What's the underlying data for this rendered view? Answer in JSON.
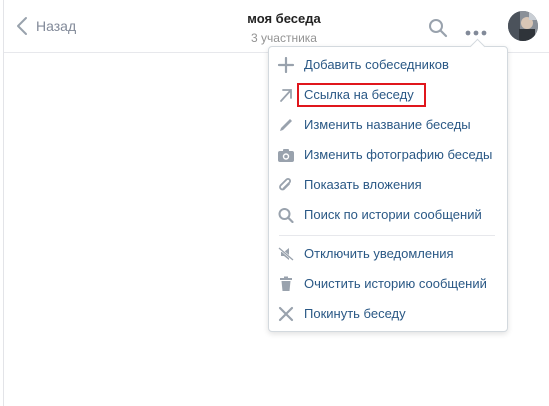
{
  "header": {
    "back_label": "Назад",
    "title": "моя беседа",
    "subtitle": "3 участника"
  },
  "icons": {
    "back": "chevron-left-icon",
    "search": "search-icon",
    "more": "more-horizontal-icon"
  },
  "menu": {
    "items": [
      {
        "label": "Добавить собеседников",
        "icon": "plus-icon"
      },
      {
        "label": "Ссылка на беседу",
        "icon": "arrow-up-right-icon"
      },
      {
        "label": "Изменить название беседы",
        "icon": "pencil-icon"
      },
      {
        "label": "Изменить фотографию беседы",
        "icon": "camera-icon"
      },
      {
        "label": "Показать вложения",
        "icon": "paperclip-icon"
      },
      {
        "label": "Поиск по истории сообщений",
        "icon": "search-icon"
      },
      {
        "label": "Отключить уведомления",
        "icon": "bell-off-icon"
      },
      {
        "label": "Очистить историю сообщений",
        "icon": "trash-icon"
      },
      {
        "label": "Покинуть беседу",
        "icon": "close-icon"
      }
    ]
  },
  "colors": {
    "link": "#2a5885",
    "icon": "#99a2ad",
    "highlight": "#e0161c",
    "muted": "#828a99"
  }
}
